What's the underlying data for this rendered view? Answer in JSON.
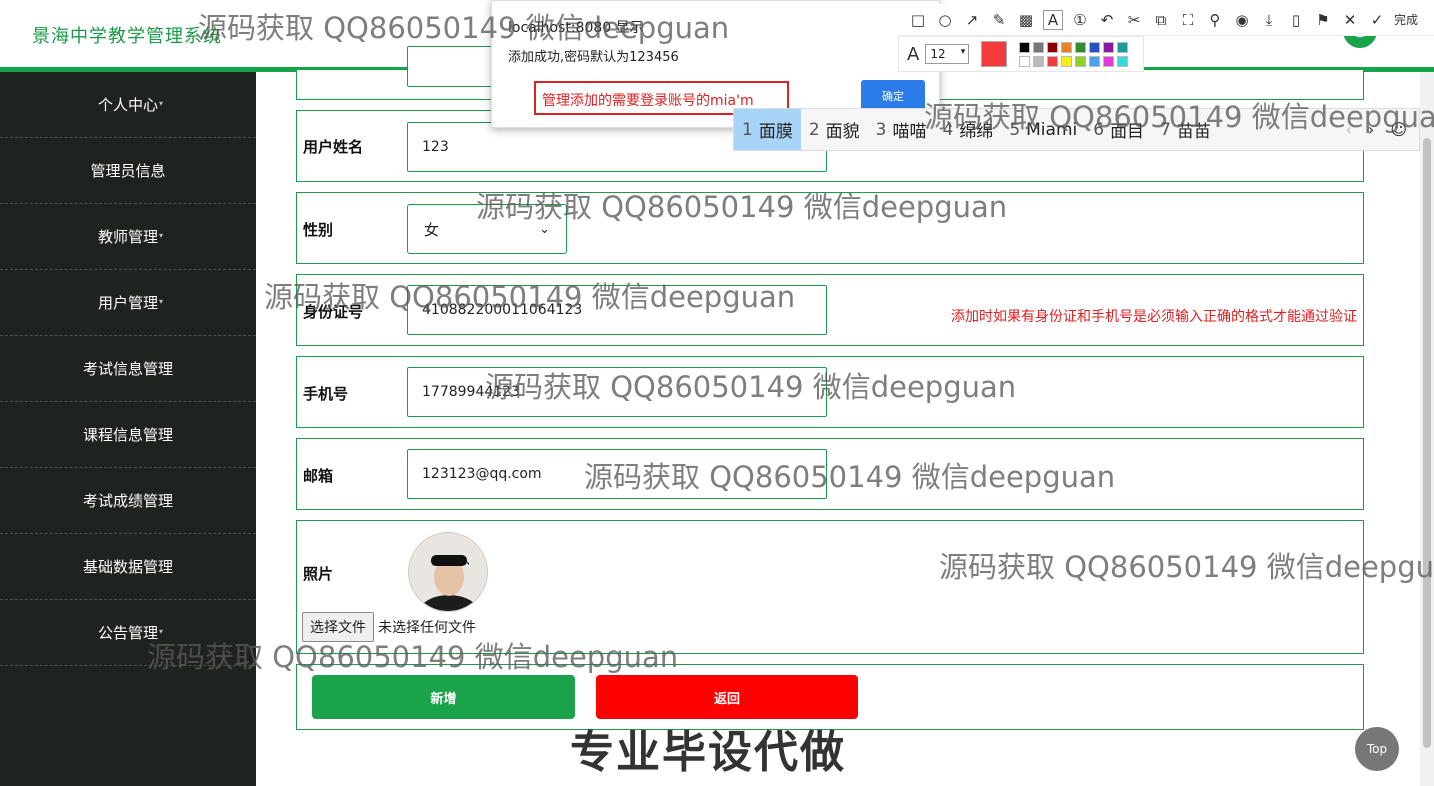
{
  "app": {
    "title": "景海中学教学管理系统",
    "avatar_icon": "user-icon"
  },
  "sidebar": {
    "items": [
      {
        "label": "个人中心"
      },
      {
        "label": "管理员信息"
      },
      {
        "label": "教师管理"
      },
      {
        "label": "用户管理"
      },
      {
        "label": "考试信息管理"
      },
      {
        "label": "课程信息管理"
      },
      {
        "label": "考试成绩管理"
      },
      {
        "label": "基础数据管理"
      },
      {
        "label": "公告管理"
      }
    ]
  },
  "form": {
    "name_label": "用户姓名",
    "name_value": "123",
    "gender_label": "性别",
    "gender_value": "女",
    "id_label": "身份证号",
    "id_value": "410882200011064123",
    "id_hint": "添加时如果有身份证和手机号是必须输入正确的格式才能通过验证",
    "phone_label": "手机号",
    "phone_value": "17789944123",
    "email_label": "邮箱",
    "email_value": "123123@qq.com",
    "photo_label": "照片",
    "file_button": "选择文件",
    "file_status": "未选择任何文件",
    "add_button": "新增",
    "back_button": "返回"
  },
  "top_button": "Top",
  "dialog": {
    "title": "localhost:8080 显示",
    "message": "添加成功,密码默认为123456",
    "input_value": "管理添加的需要登录账号的mia'm",
    "ok_button": "确定"
  },
  "ime": {
    "candidates": [
      {
        "n": "1",
        "text": "面膜"
      },
      {
        "n": "2",
        "text": "面貌"
      },
      {
        "n": "3",
        "text": "喵喵"
      },
      {
        "n": "4",
        "text": "绵绵"
      },
      {
        "n": "5",
        "text": "Miami"
      },
      {
        "n": "6",
        "text": "面目"
      },
      {
        "n": "7",
        "text": "苗苗"
      }
    ],
    "prev": "‹",
    "next": "›",
    "emoji": "☺"
  },
  "annot_toolbar": {
    "done_label": "完成",
    "font_size": "12",
    "current_color": "#f23b3b"
  },
  "watermarks": {
    "text": "源码获取 QQ86050149 微信deepguan",
    "text_cut1": "源码获取 QQ86050149 微信deepgua",
    "text_cut2": "源码获取 QQ86050149 微信deepgu",
    "big": "专业毕设代做"
  },
  "colors": {
    "brand_green": "#1aa34a",
    "danger_red": "#ff0000",
    "sidebar_bg": "#1f2320"
  }
}
